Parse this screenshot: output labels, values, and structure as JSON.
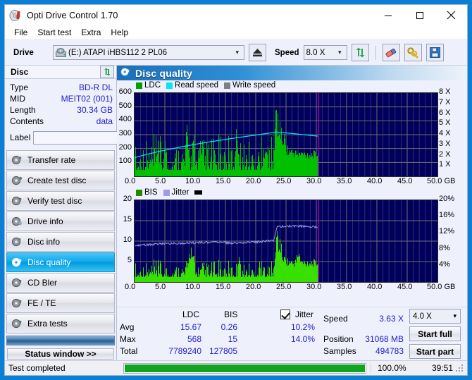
{
  "window": {
    "title": "Opti Drive Control 1.70",
    "icon": "disc-icon",
    "controls": {
      "minimize": "–",
      "maximize": "☐",
      "close": "✕"
    }
  },
  "menu": {
    "items": [
      "File",
      "Start test",
      "Extra",
      "Help"
    ]
  },
  "toolbar": {
    "drive_label": "Drive",
    "drive_value": "(E:)   ATAPI iHBS112  2 PL06",
    "eject_icon": "eject-icon",
    "speed_label": "Speed",
    "speed_value": "8.0 X",
    "refresh_icon": "refresh-icon",
    "erase_icon": "eraser-icon",
    "info_icon": "keys-icon",
    "save_icon": "save-icon"
  },
  "disc_panel": {
    "title": "Disc",
    "refresh_icon": "refresh-icon",
    "rows": [
      {
        "key": "Type",
        "value": "BD-R DL"
      },
      {
        "key": "MID",
        "value": "MEIT02 (001)"
      },
      {
        "key": "Length",
        "value": "30.34 GB"
      },
      {
        "key": "Contents",
        "value": "data"
      }
    ],
    "label_key": "Label",
    "label_value": "",
    "label_placeholder": "",
    "label_button_icon": "disc-icon"
  },
  "sidebar": {
    "items": [
      {
        "label": "Transfer rate",
        "icon": "disc-icon",
        "selected": false
      },
      {
        "label": "Create test disc",
        "icon": "disc-icon",
        "selected": false
      },
      {
        "label": "Verify test disc",
        "icon": "disc-icon",
        "selected": false
      },
      {
        "label": "Drive info",
        "icon": "disc-icon",
        "selected": false
      },
      {
        "label": "Disc info",
        "icon": "disc-icon",
        "selected": false
      },
      {
        "label": "Disc quality",
        "icon": "disc-icon",
        "selected": true
      },
      {
        "label": "CD Bler",
        "icon": "disc-icon",
        "selected": false
      },
      {
        "label": "FE / TE",
        "icon": "disc-icon",
        "selected": false
      },
      {
        "label": "Extra tests",
        "icon": "disc-icon",
        "selected": false
      }
    ],
    "status_window_button": "Status window >>"
  },
  "panel": {
    "title": "Disc quality",
    "icon": "disc-icon"
  },
  "stats": {
    "col_ldc": "LDC",
    "col_bis": "BIS",
    "jitter_label": "Jitter",
    "jitter_checked": true,
    "rows": [
      {
        "name": "Avg",
        "ldc": "15.67",
        "bis": "0.26",
        "jitter": "10.2%"
      },
      {
        "name": "Max",
        "ldc": "568",
        "bis": "15",
        "jitter": "14.0%"
      },
      {
        "name": "Total",
        "ldc": "7789240",
        "bis": "127805",
        "jitter": ""
      }
    ],
    "speed_label": "Speed",
    "speed_value": "3.63 X",
    "position_label": "Position",
    "position_value": "31068 MB",
    "samples_label": "Samples",
    "samples_value": "494783",
    "speed_select": "4.0 X",
    "start_full": "Start full",
    "start_part": "Start part"
  },
  "statusbar": {
    "text": "Test completed",
    "progress_percent": "100.0%",
    "progress_value": 100,
    "elapsed": "39:51"
  },
  "colors": {
    "plot_bg": "#00005c",
    "ldc_green": "#00c000",
    "bis_green": "#38e000",
    "read_speed_cyan": "#00e8f8",
    "jitter_lilac": "#9a9aee",
    "write_speed_gray": "#808080",
    "marker_magenta": "#d000d0",
    "progress_green": "#11a422",
    "accent_blue": "#0a7fd4",
    "value_blue": "#2222cc"
  },
  "chart_data": [
    {
      "type": "area",
      "title": "Disc quality — LDC / Read speed",
      "xlabel": "GB",
      "ylabel": "LDC",
      "y2label": "X",
      "xlim": [
        0.0,
        50.0
      ],
      "ylim": [
        0,
        600
      ],
      "y2lim": [
        0,
        8
      ],
      "grid": true,
      "legend_position": "top-left",
      "xticks": [
        "0.0",
        "5.0",
        "10.0",
        "15.0",
        "20.0",
        "25.0",
        "30.0",
        "35.0",
        "40.0",
        "45.0",
        "50.0 GB"
      ],
      "yticks": [
        100,
        200,
        300,
        400,
        500,
        600
      ],
      "y2ticks": [
        "1 X",
        "2 X",
        "3 X",
        "4 X",
        "5 X",
        "6 X",
        "7 X",
        "8 X"
      ],
      "legend": [
        {
          "name": "LDC",
          "color": "#00c000"
        },
        {
          "name": "Read speed",
          "color": "#00e8f8"
        },
        {
          "name": "Write speed",
          "color": "#808080"
        }
      ],
      "data_end_gb": 30.34,
      "marker_gb": 30.34,
      "series": [
        {
          "name": "LDC",
          "type": "area",
          "color": "#00c000",
          "x": [
            0.1,
            0.3,
            0.6,
            0.9,
            1.2,
            1.6,
            2.0,
            2.4,
            2.8,
            3.2,
            3.6,
            3.9,
            4.0,
            4.2,
            4.6,
            5.0,
            5.4,
            5.8,
            6.2,
            6.6,
            7.0,
            7.4,
            7.8,
            8.2,
            8.6,
            9.0,
            9.3,
            9.5,
            9.7,
            10.0,
            10.4,
            10.8,
            11.0,
            11.2,
            11.6,
            12.0,
            12.4,
            12.8,
            13.2,
            13.6,
            14.0,
            14.4,
            14.8,
            15.2,
            15.6,
            16.0,
            16.4,
            16.8,
            17.2,
            17.5,
            17.7,
            18.0,
            18.4,
            18.8,
            19.2,
            19.6,
            20.0,
            20.4,
            20.8,
            21.2,
            21.6,
            22.0,
            22.4,
            22.8,
            23.0,
            23.2,
            23.3,
            23.4,
            23.5,
            23.6,
            23.8,
            24.0,
            24.2,
            24.4,
            24.6,
            24.8,
            25.0,
            25.4,
            25.8,
            26.2,
            26.6,
            27.0,
            27.4,
            27.8,
            28.2,
            28.6,
            29.0,
            29.4,
            29.8,
            30.2,
            30.34
          ],
          "y": [
            180,
            70,
            60,
            55,
            65,
            60,
            70,
            55,
            65,
            60,
            55,
            345,
            120,
            60,
            70,
            230,
            60,
            55,
            75,
            60,
            65,
            60,
            55,
            70,
            360,
            150,
            110,
            60,
            300,
            130,
            55,
            250,
            70,
            60,
            65,
            60,
            70,
            55,
            160,
            60,
            110,
            60,
            70,
            55,
            60,
            120,
            65,
            345,
            150,
            60,
            70,
            60,
            130,
            55,
            60,
            70,
            60,
            155,
            70,
            60,
            250,
            80,
            70,
            120,
            200,
            470,
            575,
            430,
            300,
            490,
            350,
            410,
            300,
            260,
            300,
            240,
            200,
            175,
            165,
            160,
            150,
            150,
            145,
            150,
            140,
            145,
            140,
            145,
            140,
            150,
            150
          ]
        },
        {
          "name": "Read speed",
          "type": "line",
          "color": "#00e8f8",
          "unit": "X",
          "x": [
            0.0,
            2.0,
            4.0,
            6.0,
            8.0,
            10.0,
            12.0,
            14.0,
            16.0,
            18.0,
            20.0,
            22.0,
            23.5,
            24.0,
            25.0,
            26.0,
            27.0,
            28.0,
            29.0,
            30.0,
            30.34
          ],
          "y": [
            1.79,
            2.1,
            2.38,
            2.62,
            2.86,
            3.07,
            3.27,
            3.45,
            3.63,
            3.8,
            3.96,
            4.13,
            4.25,
            4.22,
            4.17,
            4.11,
            4.05,
            3.99,
            3.93,
            3.87,
            3.85
          ]
        }
      ]
    },
    {
      "type": "area",
      "title": "Disc quality — BIS / Jitter",
      "xlabel": "GB",
      "ylabel": "BIS",
      "y2label": "%",
      "xlim": [
        0.0,
        50.0
      ],
      "ylim": [
        0,
        20
      ],
      "y2lim": [
        0,
        20
      ],
      "grid": true,
      "legend_position": "top-left",
      "xticks": [
        "0.0",
        "5.0",
        "10.0",
        "15.0",
        "20.0",
        "25.0",
        "30.0",
        "35.0",
        "40.0",
        "45.0",
        "50.0 GB"
      ],
      "yticks": [
        5,
        10,
        15,
        20
      ],
      "y2ticks": [
        "4%",
        "8%",
        "12%",
        "16%",
        "20%"
      ],
      "legend": [
        {
          "name": "BIS",
          "color": "#2ca000"
        },
        {
          "name": "Jitter",
          "color": "#9a9aee"
        }
      ],
      "data_end_gb": 30.34,
      "marker_gb": 30.34,
      "series": [
        {
          "name": "BIS",
          "type": "area",
          "color": "#38e000",
          "x": [
            0.1,
            0.4,
            0.8,
            1.2,
            1.6,
            2.0,
            2.4,
            2.8,
            3.0,
            3.2,
            3.6,
            3.9,
            4.0,
            4.3,
            4.7,
            5.0,
            5.4,
            5.8,
            6.2,
            6.6,
            7.0,
            7.4,
            7.8,
            8.2,
            8.6,
            9.0,
            9.3,
            9.5,
            9.7,
            10.0,
            10.4,
            10.8,
            11.2,
            11.6,
            12.0,
            12.4,
            12.8,
            13.2,
            13.6,
            14.0,
            14.4,
            14.8,
            15.2,
            15.6,
            16.0,
            16.4,
            16.8,
            17.2,
            17.5,
            17.8,
            18.2,
            18.6,
            19.0,
            19.4,
            19.8,
            20.2,
            20.6,
            21.0,
            21.4,
            21.8,
            22.2,
            22.6,
            23.0,
            23.3,
            23.5,
            23.6,
            23.8,
            24.0,
            24.3,
            24.6,
            25.0,
            25.4,
            25.8,
            26.2,
            26.6,
            27.0,
            27.4,
            27.8,
            28.2,
            28.6,
            29.0,
            29.4,
            29.8,
            30.2,
            30.34
          ],
          "y": [
            3.0,
            1.4,
            1.3,
            1.2,
            1.4,
            1.3,
            1.2,
            2.8,
            1.4,
            2.0,
            1.5,
            6.6,
            2.2,
            3.2,
            1.4,
            3.0,
            1.4,
            1.3,
            1.5,
            1.3,
            1.4,
            1.3,
            1.4,
            1.3,
            3.0,
            7.0,
            8.2,
            5.0,
            6.0,
            3.2,
            1.4,
            3.0,
            1.4,
            1.3,
            1.4,
            1.3,
            1.5,
            1.3,
            3.4,
            1.4,
            1.3,
            1.5,
            1.3,
            1.4,
            1.4,
            1.3,
            2.2,
            6.8,
            3.0,
            1.5,
            1.4,
            2.0,
            1.4,
            1.3,
            1.5,
            1.3,
            4.6,
            1.4,
            4.2,
            1.5,
            3.6,
            1.4,
            4.0,
            8.0,
            15.0,
            12.0,
            9.0,
            11.0,
            6.5,
            5.4,
            5.0,
            4.6,
            4.4,
            4.2,
            4.6,
            7.6,
            4.4,
            4.3,
            4.2,
            4.5,
            4.3,
            4.4,
            4.2,
            4.4,
            4.3
          ]
        },
        {
          "name": "Jitter",
          "type": "line",
          "color": "#9a9aee",
          "unit": "%",
          "x": [
            0.1,
            1.0,
            2.0,
            3.0,
            4.0,
            5.0,
            6.0,
            7.0,
            8.0,
            9.0,
            10.0,
            11.0,
            12.0,
            13.0,
            14.0,
            15.0,
            16.0,
            17.0,
            18.0,
            19.0,
            20.0,
            21.0,
            22.0,
            23.0,
            23.4,
            23.6,
            24.0,
            25.0,
            26.0,
            27.0,
            28.0,
            29.0,
            30.0,
            30.34
          ],
          "y": [
            9.0,
            9.0,
            9.1,
            9.2,
            9.3,
            9.4,
            9.4,
            9.5,
            9.5,
            9.6,
            9.6,
            9.7,
            9.7,
            9.7,
            9.7,
            9.6,
            9.5,
            9.5,
            9.6,
            9.7,
            9.8,
            9.9,
            10.0,
            10.2,
            12.5,
            13.7,
            13.6,
            13.7,
            13.6,
            13.7,
            13.6,
            13.5,
            13.4,
            13.4
          ]
        }
      ]
    }
  ]
}
